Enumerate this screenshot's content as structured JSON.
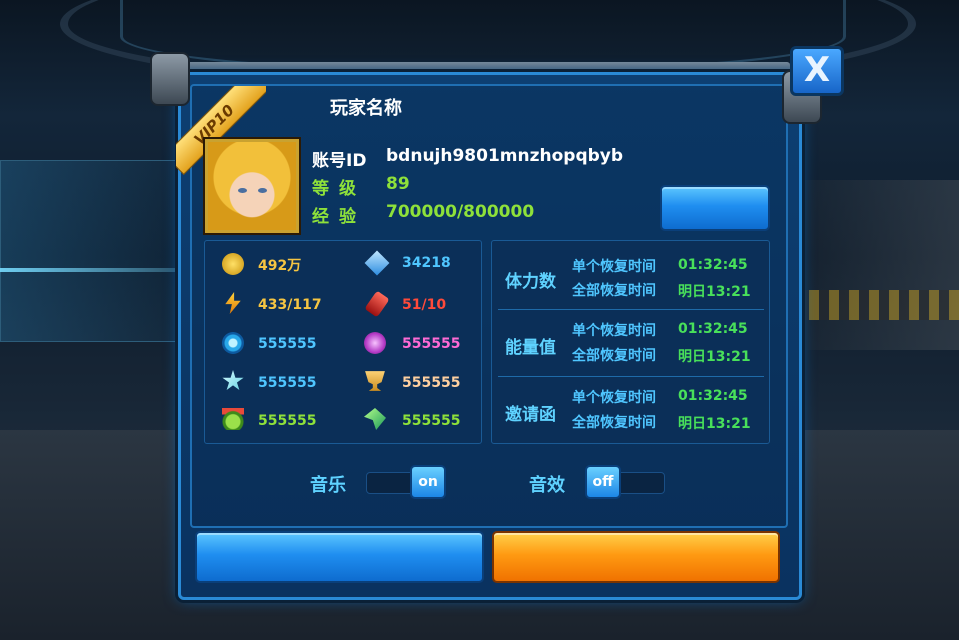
{
  "panel": {
    "title": "玩家名称",
    "vip": "VIP10",
    "close_icon": "X"
  },
  "profile": {
    "id_label": "账号ID",
    "id_value": "bdnujh9801mnzhopqbyb",
    "level_label": "等级",
    "level_value": "89",
    "exp_label": "经验",
    "exp_value": "700000/800000"
  },
  "resources": [
    {
      "icon": "gold-coin-icon",
      "value": "492万",
      "color": "#f5c542"
    },
    {
      "icon": "diamond-icon",
      "value": "34218",
      "color": "#4fc6ff"
    },
    {
      "icon": "energy-bolt-icon",
      "value": "433/117",
      "color": "#f5c542"
    },
    {
      "icon": "potion-icon",
      "value": "51/10",
      "color": "#ff4a3a"
    },
    {
      "icon": "gear-icon",
      "value": "555555",
      "color": "#4fc6ff"
    },
    {
      "icon": "crystal-icon",
      "value": "555555",
      "color": "#ff6ad5"
    },
    {
      "icon": "star-icon",
      "value": "555555",
      "color": "#4fc6ff"
    },
    {
      "icon": "trophy-icon",
      "value": "555555",
      "color": "#ffd0a0"
    },
    {
      "icon": "medal-icon",
      "value": "555555",
      "color": "#8ee13a"
    },
    {
      "icon": "leaf-icon",
      "value": "555555",
      "color": "#8ee13a"
    }
  ],
  "timers": [
    {
      "name": "体力数",
      "single_label": "单个恢复时间",
      "single_value": "01:32:45",
      "all_label": "全部恢复时间",
      "all_value": "明日13:21"
    },
    {
      "name": "能量值",
      "single_label": "单个恢复时间",
      "single_value": "01:32:45",
      "all_label": "全部恢复时间",
      "all_value": "明日13:21"
    },
    {
      "name": "邀请函",
      "single_label": "单个恢复时间",
      "single_value": "01:32:45",
      "all_label": "全部恢复时间",
      "all_value": "明日13:21"
    }
  ],
  "settings": {
    "music_label": "音乐",
    "music_state": "on",
    "sound_label": "音效",
    "sound_state": "off"
  },
  "colors": {
    "accent_blue": "#1f8ef0",
    "accent_orange": "#ff9a12",
    "green_text": "#8ee13a",
    "cyan_text": "#4fc6ff"
  }
}
